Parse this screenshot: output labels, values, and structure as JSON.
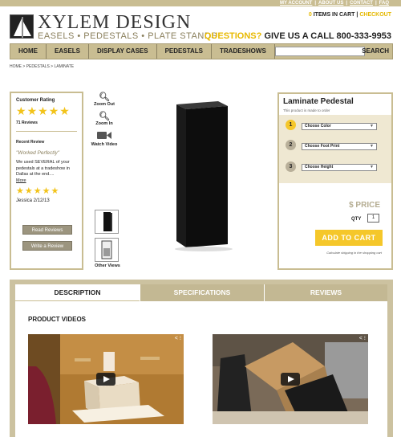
{
  "top_links": [
    "MY ACCOUNT",
    "ABOUT US",
    "CONTACT",
    "FAQ"
  ],
  "brand": {
    "name": "XYLEM DESIGN",
    "tagline": "EASELS • PEDESTALS • PLATE STANDS"
  },
  "cart": {
    "count": "0",
    "label": "ITEMS IN CART",
    "separator": "|",
    "checkout": "CHECKOUT"
  },
  "phone": {
    "questions": "QUESTIONS?",
    "text": "GIVE US A CALL 800-333-9953"
  },
  "nav": {
    "items": [
      "HOME",
      "EASELS",
      "DISPLAY CASES",
      "PEDESTALS",
      "TRADESHOWS"
    ],
    "search_label": "SEARCH",
    "search_placeholder": ""
  },
  "breadcrumb": "HOME > PEDESTALS > LAMINATE",
  "reviews": {
    "title": "Customer Rating",
    "rating": 5,
    "count": "71 Reviews",
    "recent_label": "Recent Review",
    "quote": "\"Worked Perfectly\"",
    "body": "We used SEVERAL of your pedestals at a tradeshow in Dallas at the end....",
    "more": "More",
    "review_rating": 5,
    "author": "Jessica 2/12/13",
    "read_button": "Read Reviews",
    "write_button": "Write a Review"
  },
  "tools": {
    "zoom_out": "Zoom Out",
    "zoom_in": "Zoom In",
    "watch_video": "Watch Video",
    "other_views": "Other Views"
  },
  "product": {
    "title": "Laminate Pedestal",
    "subtitle": "This product is made to order",
    "steps": [
      {
        "number": "1",
        "label": "Choose Color",
        "accent": "#f5c72a"
      },
      {
        "number": "2",
        "label": "Choose Foot Print",
        "accent": "#b9b09a"
      },
      {
        "number": "3",
        "label": "Choose Height",
        "accent": "#b9b09a"
      }
    ],
    "price": "$ PRICE",
    "qty_label": "QTY",
    "qty_value": "1",
    "add_to_cart": "ADD TO CART",
    "ship_note": "Calculate shipping in the shopping cart"
  },
  "tabs": [
    "DESCRIPTION",
    "SPECIFICATIONS",
    "REVIEWS"
  ],
  "product_videos_title": "PRODUCT VIDEOS",
  "colors": {
    "accent_tan": "#c9bd92",
    "accent_yellow": "#f5c72a",
    "star": "#f2c31a"
  }
}
